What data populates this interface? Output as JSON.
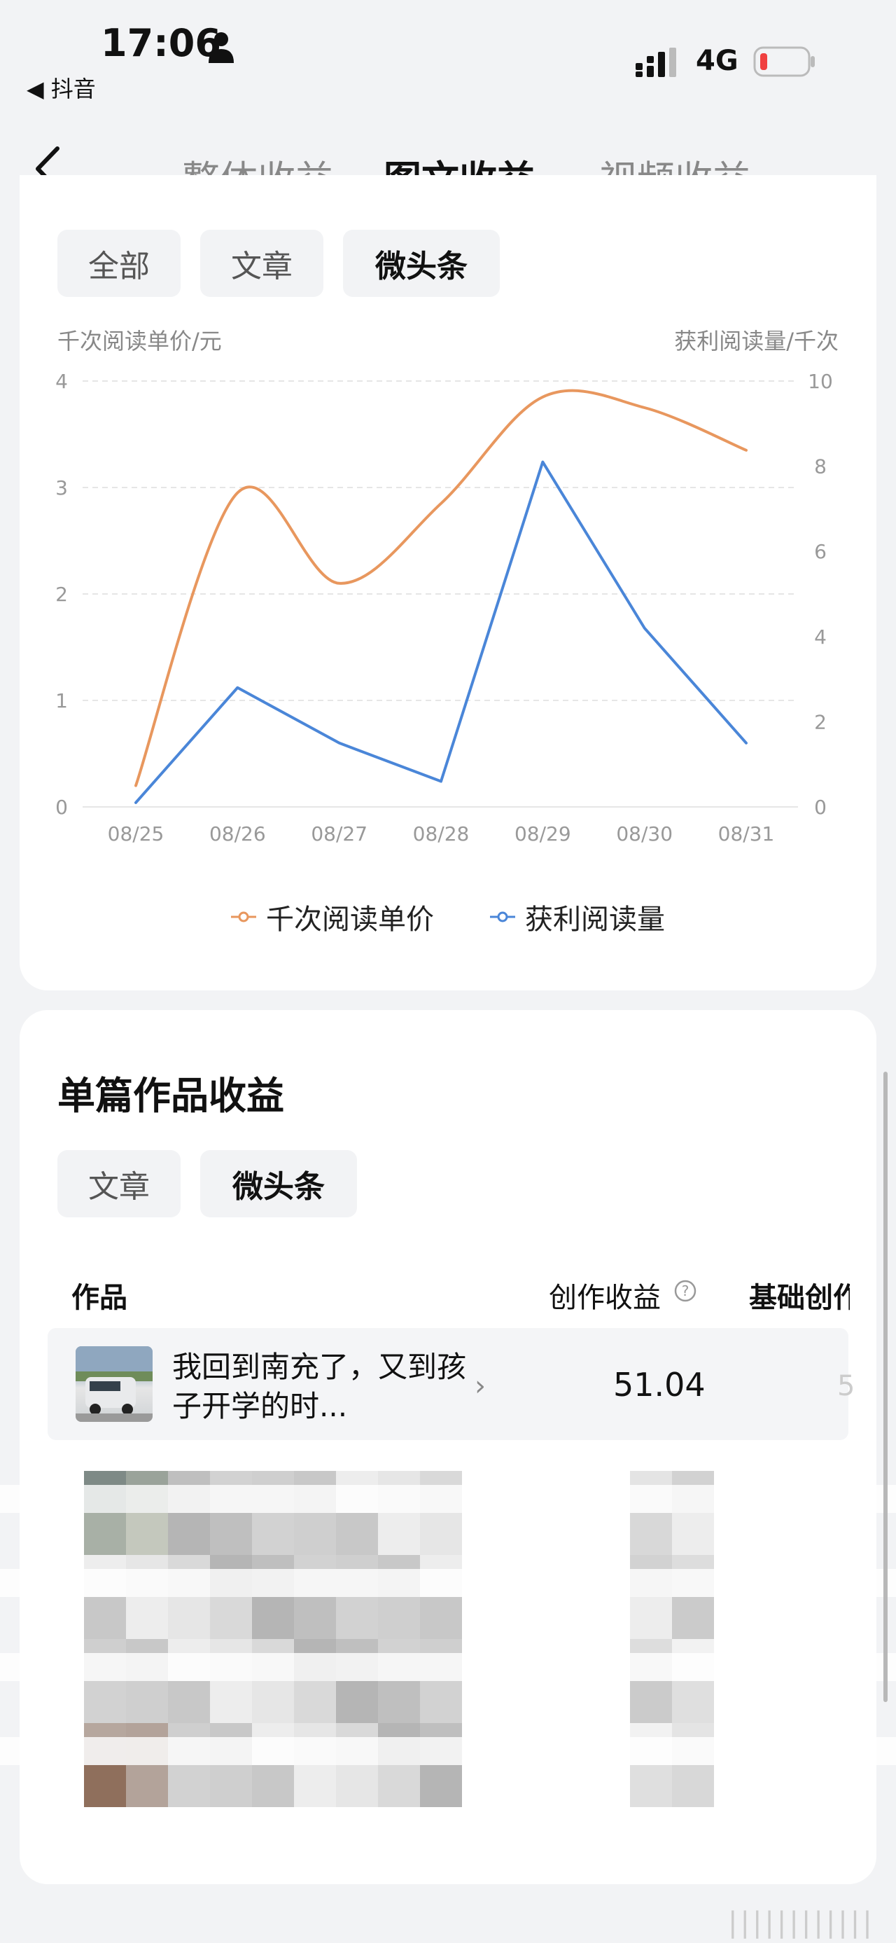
{
  "status_bar": {
    "time": "17:06",
    "back_app": "◀ 抖音",
    "network": "4G"
  },
  "nav": {
    "tabs": [
      "整体收益",
      "图文收益",
      "视频收益"
    ],
    "active_tab": 1
  },
  "filter_chips": [
    "全部",
    "文章",
    "微头条"
  ],
  "filter_selected": 2,
  "chart_data": {
    "type": "line",
    "x": [
      "08/25",
      "08/26",
      "08/27",
      "08/28",
      "08/29",
      "08/30",
      "08/31"
    ],
    "y_left_label": "千次阅读单价/元",
    "y_right_label": "获利阅读量/千次",
    "y_left_ticks": [
      "4",
      "3",
      "2",
      "1",
      "0"
    ],
    "y_right_ticks": [
      "10",
      "8",
      "6",
      "4",
      "2",
      "0"
    ],
    "y_left_range": [
      0,
      4
    ],
    "y_right_range": [
      0,
      10
    ],
    "series": [
      {
        "name": "千次阅读单价",
        "axis": "left",
        "color": "#E8975E",
        "smooth": true,
        "values": [
          0.2,
          2.95,
          2.1,
          2.85,
          3.85,
          3.75,
          3.35
        ]
      },
      {
        "name": "获利阅读量",
        "axis": "right",
        "color": "#4A86D8",
        "smooth": false,
        "values": [
          0.1,
          2.8,
          1.5,
          0.6,
          8.1,
          4.2,
          1.5
        ]
      }
    ],
    "grid": "horizontal dashed",
    "legend": "bottom-center"
  },
  "section": {
    "title": "单篇作品收益",
    "chips": [
      "文章",
      "微头条"
    ],
    "selected": 1
  },
  "table": {
    "headers": {
      "works": "作品",
      "earnings": "创作收益",
      "basic": "基础创作"
    },
    "rows": [
      {
        "title": "我回到南充了，又到孩子开学的时...",
        "value": "51.04"
      }
    ]
  },
  "colors": {
    "orange": "#E8975E",
    "blue": "#4A86D8"
  }
}
